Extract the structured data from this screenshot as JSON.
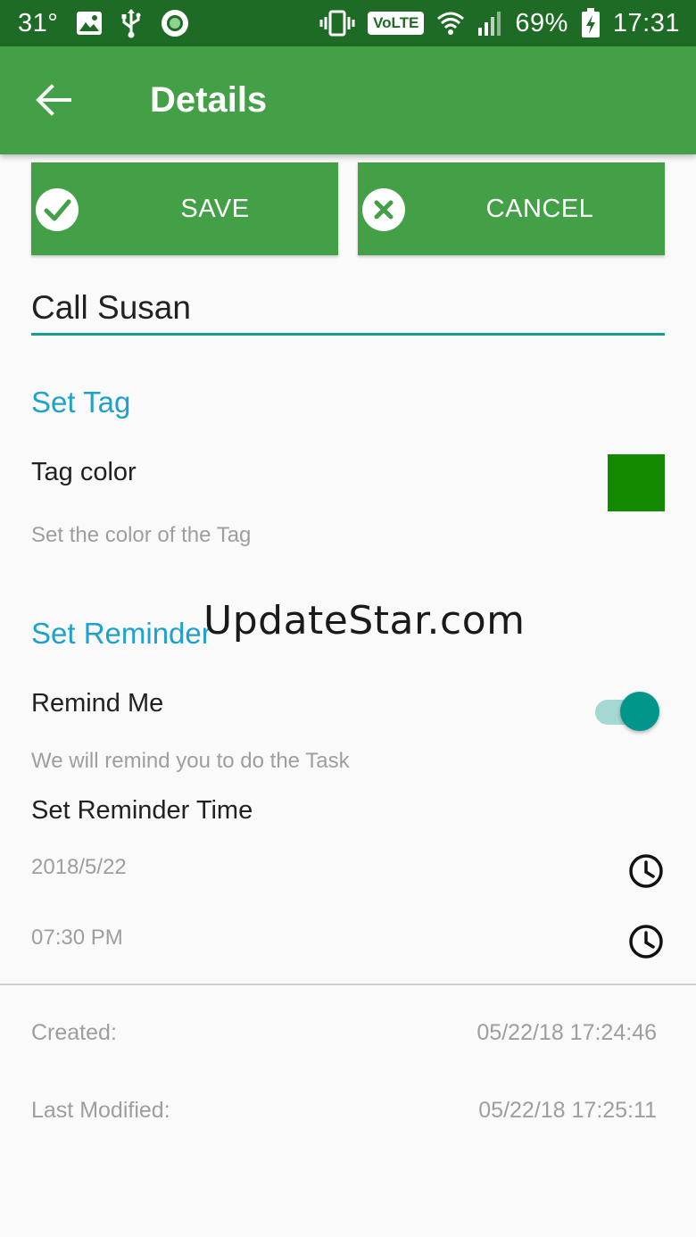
{
  "status_bar": {
    "temperature": "31°",
    "volte": "VoLTE",
    "battery": "69%",
    "time": "17:31"
  },
  "app_bar": {
    "title": "Details"
  },
  "actions": {
    "save_label": "SAVE",
    "cancel_label": "CANCEL"
  },
  "task": {
    "title": "Call Susan"
  },
  "tag_section": {
    "heading": "Set Tag",
    "tag_color_title": "Tag color",
    "tag_color_summary": "Set the color of the Tag",
    "tag_color_value": "#148a00"
  },
  "reminder_section": {
    "heading": "Set Reminder",
    "remind_me_title": "Remind Me",
    "remind_me_summary": "We will remind you to do the Task",
    "remind_me_enabled": true,
    "reminder_time_title": "Set Reminder Time",
    "date": "2018/5/22",
    "time": "07:30 PM"
  },
  "meta": {
    "created_label": "Created:",
    "created_value": "05/22/18 17:24:46",
    "modified_label": "Last Modified:",
    "modified_value": "05/22/18 17:25:11"
  },
  "watermark": "UpdateStar.com",
  "colors": {
    "status_bar": "#1e6b25",
    "app_bar": "#43a047",
    "accent": "#1a9c8c",
    "section_heading": "#1ea1cc"
  }
}
